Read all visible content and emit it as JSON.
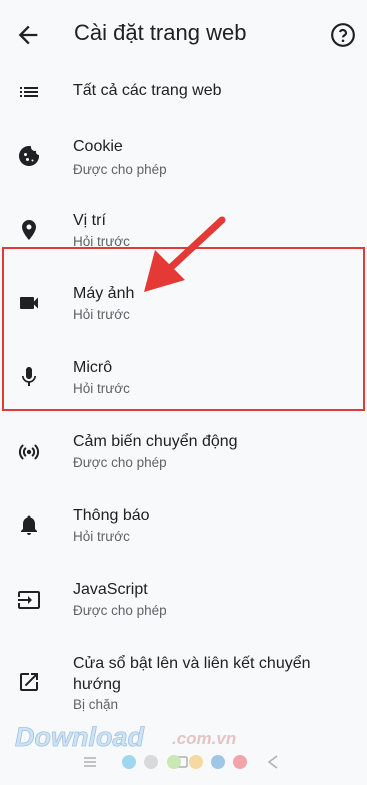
{
  "header": {
    "title": "Cài đặt trang web"
  },
  "items": [
    {
      "label": "Tất cả các trang web",
      "sub": ""
    },
    {
      "label": "Cookie",
      "sub": "Được cho phép"
    },
    {
      "label": "Vị trí",
      "sub": "Hỏi trước"
    },
    {
      "label": "Máy ảnh",
      "sub": "Hỏi trước"
    },
    {
      "label": "Micrô",
      "sub": "Hỏi trước"
    },
    {
      "label": "Cảm biến chuyển động",
      "sub": "Được cho phép"
    },
    {
      "label": "Thông báo",
      "sub": "Hỏi trước"
    },
    {
      "label": "JavaScript",
      "sub": "Được cho phép"
    },
    {
      "label": "Cửa sổ bật lên và liên kết chuyển",
      "label2": "hướng",
      "sub": "Bị chặn"
    }
  ],
  "watermark": {
    "brand": "Download",
    "suffix": ".com.vn"
  },
  "colors": {
    "accent": "#e53935",
    "icon": "#202124",
    "secondary": "#5f6368"
  }
}
